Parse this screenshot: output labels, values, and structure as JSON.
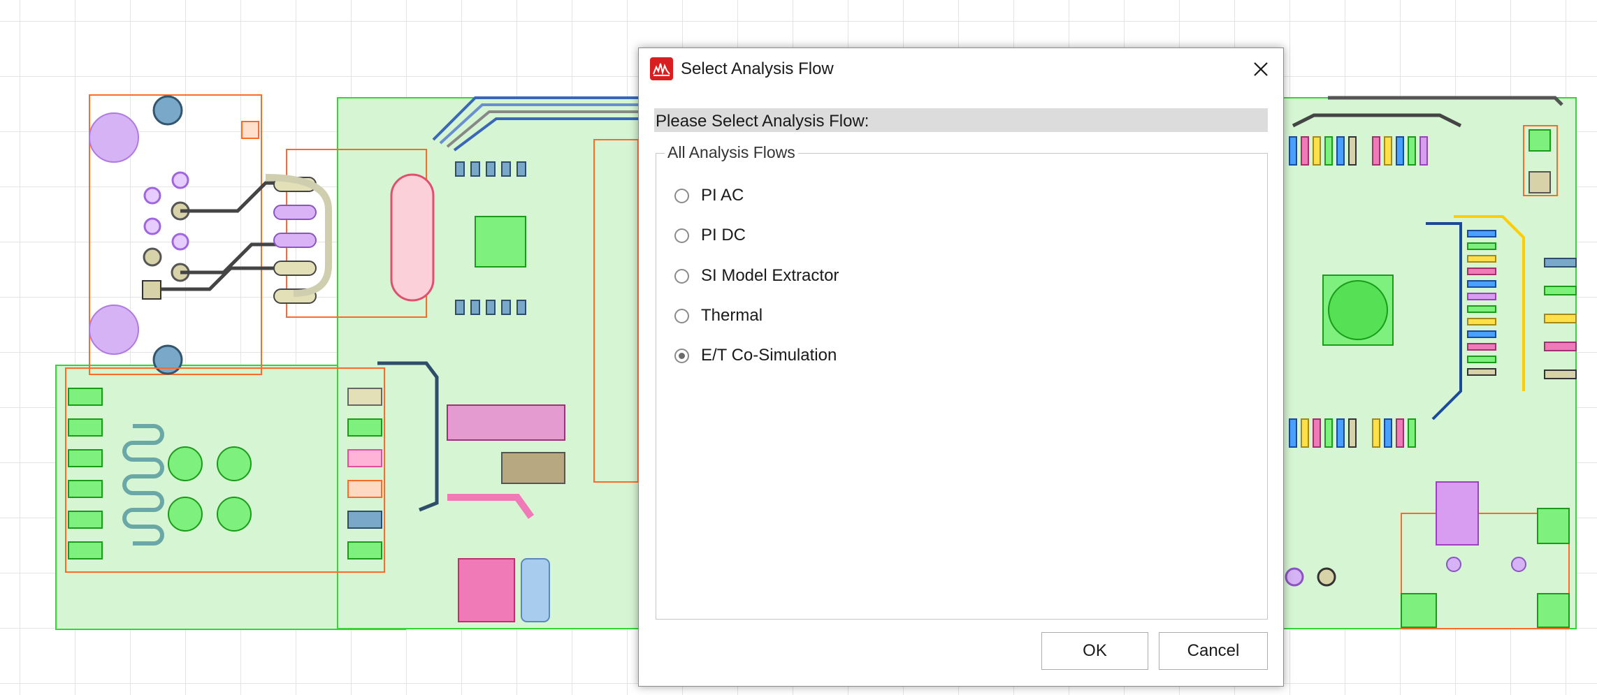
{
  "dialog": {
    "title": "Select Analysis Flow",
    "prompt": "Please Select Analysis Flow:",
    "group_label": "All Analysis Flows",
    "options": [
      {
        "label": "PI AC",
        "checked": false
      },
      {
        "label": "PI DC",
        "checked": false
      },
      {
        "label": "SI Model Extractor",
        "checked": false
      },
      {
        "label": "Thermal",
        "checked": false
      },
      {
        "label": "E/T Co-Simulation",
        "checked": true
      }
    ],
    "ok_label": "OK",
    "cancel_label": "Cancel",
    "icons": {
      "app": "app-logo-icon",
      "close": "close-icon"
    }
  },
  "colors": {
    "board_fill": "#d6f5d3",
    "board_outline": "#33d633",
    "component_outline": "#ff6a2b",
    "app_icon": "#d81e1e"
  }
}
